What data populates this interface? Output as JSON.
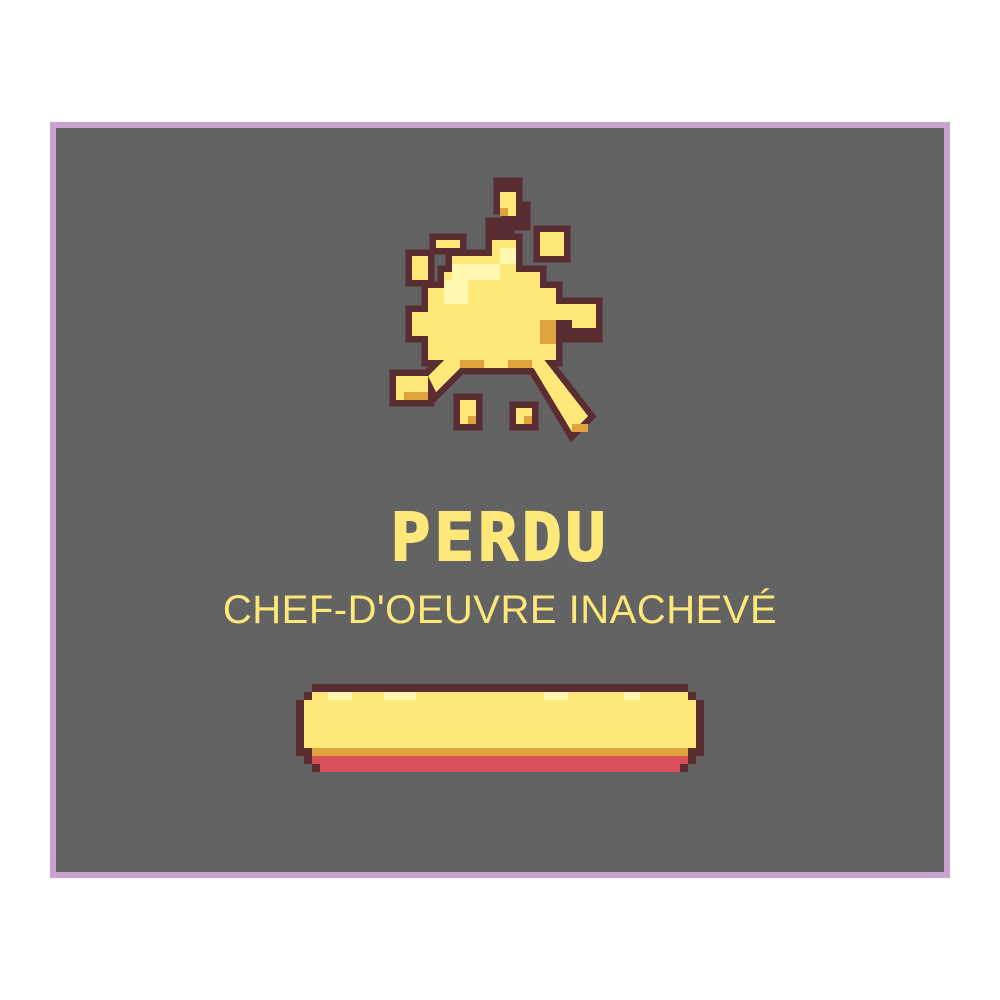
{
  "screen": {
    "name": "game-over-dialog",
    "title": "PERDU",
    "subtitle": "CHEF-D'OEUVRE INACHEVÉ",
    "button_label": ""
  },
  "icons": {
    "splat": "paint-splat-icon"
  },
  "colors": {
    "page_background": "#ffffff",
    "panel_background": "#636363",
    "panel_border": "#c8a3d0",
    "accent_yellow": "#ffe87a",
    "highlight_yellow": "#fff6b0",
    "shadow_orange": "#e0a23a",
    "outline_dark": "#5a2d33",
    "button_shadow_red": "#d9505a"
  }
}
